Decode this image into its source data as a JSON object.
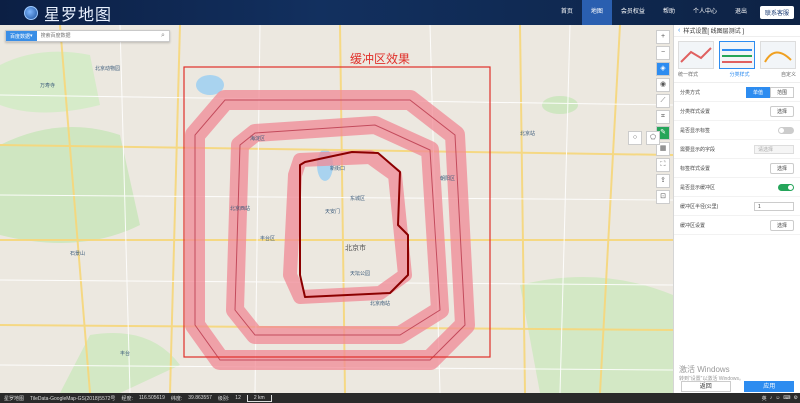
{
  "app": {
    "title": "星罗地图"
  },
  "nav": {
    "items": [
      {
        "label": "首页",
        "active": false
      },
      {
        "label": "地图",
        "active": true
      },
      {
        "label": "会员权益",
        "active": false
      },
      {
        "label": "帮助",
        "active": false
      },
      {
        "label": "个人中心",
        "active": false
      },
      {
        "label": "退出",
        "active": false
      }
    ],
    "contact": "联系客服"
  },
  "search": {
    "type": "百度数据",
    "placeholder": "搜索百度数据"
  },
  "map": {
    "annotation": "缓冲区效果",
    "labels": [
      "北京市",
      "新街口",
      "东城区",
      "天安门",
      "天坛公园",
      "北京西站",
      "北京南站",
      "中关村",
      "石景山",
      "丰台",
      "朝阳",
      "海淀区",
      "北京动物园",
      "北京站"
    ],
    "buffer_color": "#f08a96",
    "rect_color": "#e0302a",
    "route_color": "#8b0000"
  },
  "panel": {
    "title": "样式设置[ 线图层测试 ]",
    "styles": [
      {
        "label": "统一样式",
        "selected": false
      },
      {
        "label": "分类样式",
        "selected": true
      },
      {
        "label": "自定义",
        "selected": false
      }
    ],
    "rows": {
      "classify_method": "分类方式",
      "single_value": "单值",
      "range": "范围",
      "classify_style": "分类样式设置",
      "select": "选择",
      "show_label": "是否显示标签",
      "label_field": "需要显示的字段",
      "label_field_value": "请选择",
      "label_style": "标签样式设置",
      "show_buffer": "是否显示缓冲区",
      "buffer_radius": "缓冲区半径(公里)",
      "buffer_radius_value": "1",
      "buffer_style": "缓冲区设置"
    },
    "toggles": {
      "show_label": false,
      "show_buffer": true
    },
    "footer": {
      "back": "返回",
      "apply": "应用"
    },
    "watermark": "激活 Windows",
    "watermark_sub": "转到“设置”以激活 Windows。"
  },
  "status": {
    "logo": "星罗地图",
    "credit": "TileData-GoogleMap-GS(2018)5572号",
    "lng_label": "经度:",
    "lng": "116.505619",
    "lat_label": "纬度:",
    "lat": "39.863557",
    "zoom_label": "级别:",
    "zoom": "12",
    "scale": "2 km"
  },
  "tray": {
    "lang": "英",
    "items": [
      "♪",
      "☺",
      "⌨",
      "⚙"
    ]
  }
}
